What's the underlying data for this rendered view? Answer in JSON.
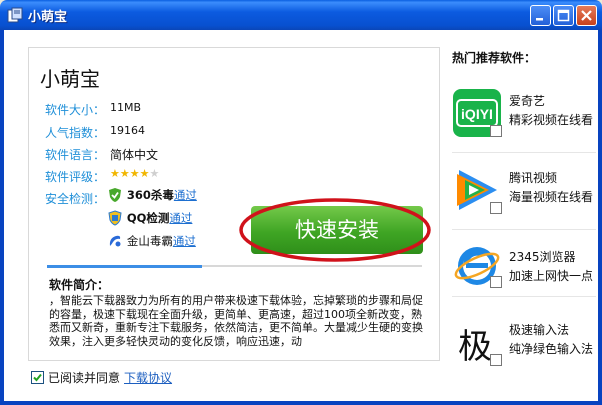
{
  "window": {
    "title": "小萌宝",
    "controls": [
      "minimize-icon",
      "maximize-icon",
      "close-icon"
    ]
  },
  "app": {
    "name": "小萌宝",
    "info": [
      {
        "label": "软件大小：",
        "value": "11MB"
      },
      {
        "label": "人气指数：",
        "value": "19164"
      },
      {
        "label": "软件语言：",
        "value": "简体中文"
      },
      {
        "label": "软件评级：",
        "value": ""
      }
    ],
    "rating": {
      "stars": 4,
      "max": 5
    },
    "security_label": "安全检测：",
    "security": [
      {
        "name": "360杀毒",
        "status": "通过",
        "icon": "360-shield-icon"
      },
      {
        "name": "QQ检测",
        "status": "通过",
        "icon": "qq-shield-icon"
      },
      {
        "name": "金山毒霸",
        "status": "通过",
        "icon": "jinshan-icon"
      }
    ],
    "install_button": "快速安装",
    "intro_title": "软件简介：",
    "intro_text": "，智能云下载器致力为所有的用户带来极速下载体验，忘掉繁琐的步骤和局促的容量，极速下载现在全面升级，更简单、更高速，超过100项全新改变，熟悉而又新奇，重新专注下载服务，依然简洁，更不简单。大量减少生硬的变换效果，注入更多轻快灵动的变化反馈，响应迅速，动"
  },
  "agreement": {
    "checked": true,
    "text": "已阅读并同意",
    "link": "下载协议"
  },
  "recommend": {
    "title": "热门推荐软件：",
    "items": [
      {
        "name": "爱奇艺",
        "desc": "精彩视频在线看",
        "icon": "iqiyi-logo-icon",
        "logo_text": "iQIYI"
      },
      {
        "name": "腾讯视频",
        "desc": "海量视频在线看",
        "icon": "tencent-video-logo-icon"
      },
      {
        "name": "2345浏览器",
        "desc": "加速上网快一点",
        "icon": "2345-browser-logo-icon"
      },
      {
        "name": "极速输入法",
        "desc": "纯净绿色输入法",
        "icon": "jisu-input-logo-icon",
        "logo_text": "极"
      }
    ]
  },
  "colors": {
    "titlebar": "#0c5be0",
    "label_blue": "#1f8fd8",
    "install_green": "#3fa524",
    "highlight_red": "#d0121b",
    "link_blue": "#1d6fd0"
  }
}
